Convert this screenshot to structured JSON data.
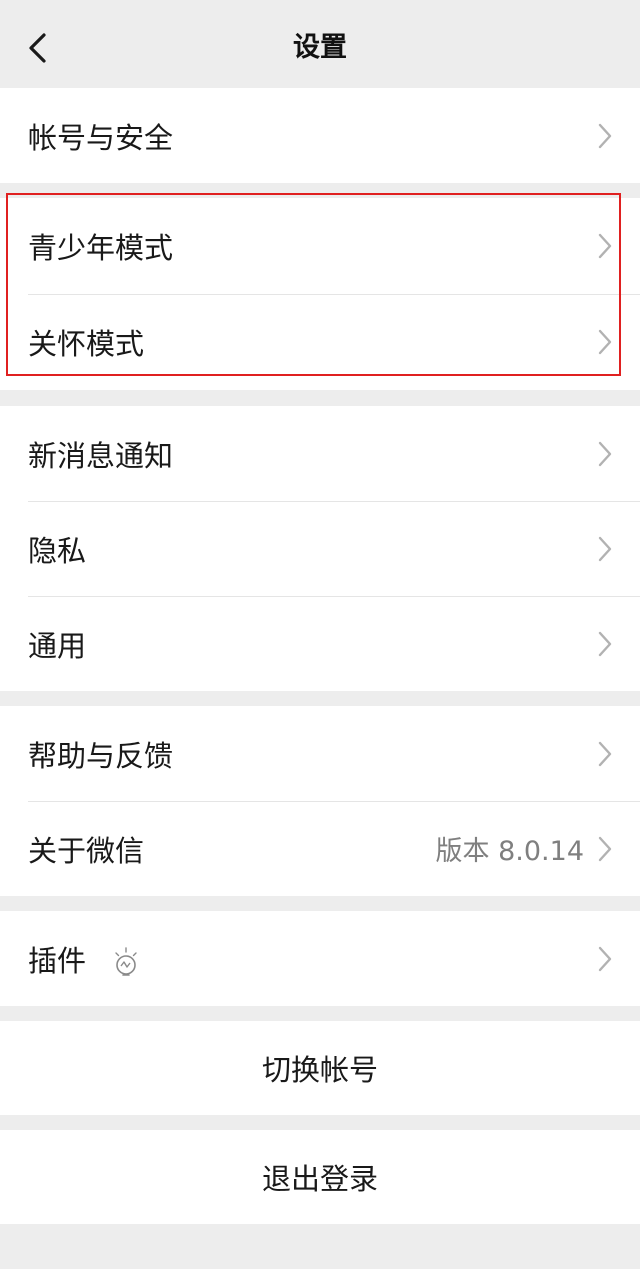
{
  "header": {
    "title": "设置",
    "back_icon": "chevron-left-icon"
  },
  "groups": [
    {
      "items": [
        {
          "label": "帐号与安全"
        }
      ]
    },
    {
      "items": [
        {
          "label": "青少年模式"
        },
        {
          "label": "关怀模式"
        }
      ]
    },
    {
      "items": [
        {
          "label": "新消息通知"
        },
        {
          "label": "隐私"
        },
        {
          "label": "通用"
        }
      ]
    },
    {
      "items": [
        {
          "label": "帮助与反馈"
        },
        {
          "label": "关于微信",
          "value": "版本 8.0.14"
        }
      ]
    },
    {
      "items": [
        {
          "label": "插件",
          "icon": "lightbulb-icon"
        }
      ]
    }
  ],
  "actions": {
    "switch_account": "切换帐号",
    "logout": "退出登录"
  },
  "colors": {
    "background": "#ededed",
    "highlight_border": "#e02020",
    "secondary_text": "#7f7f7f"
  }
}
